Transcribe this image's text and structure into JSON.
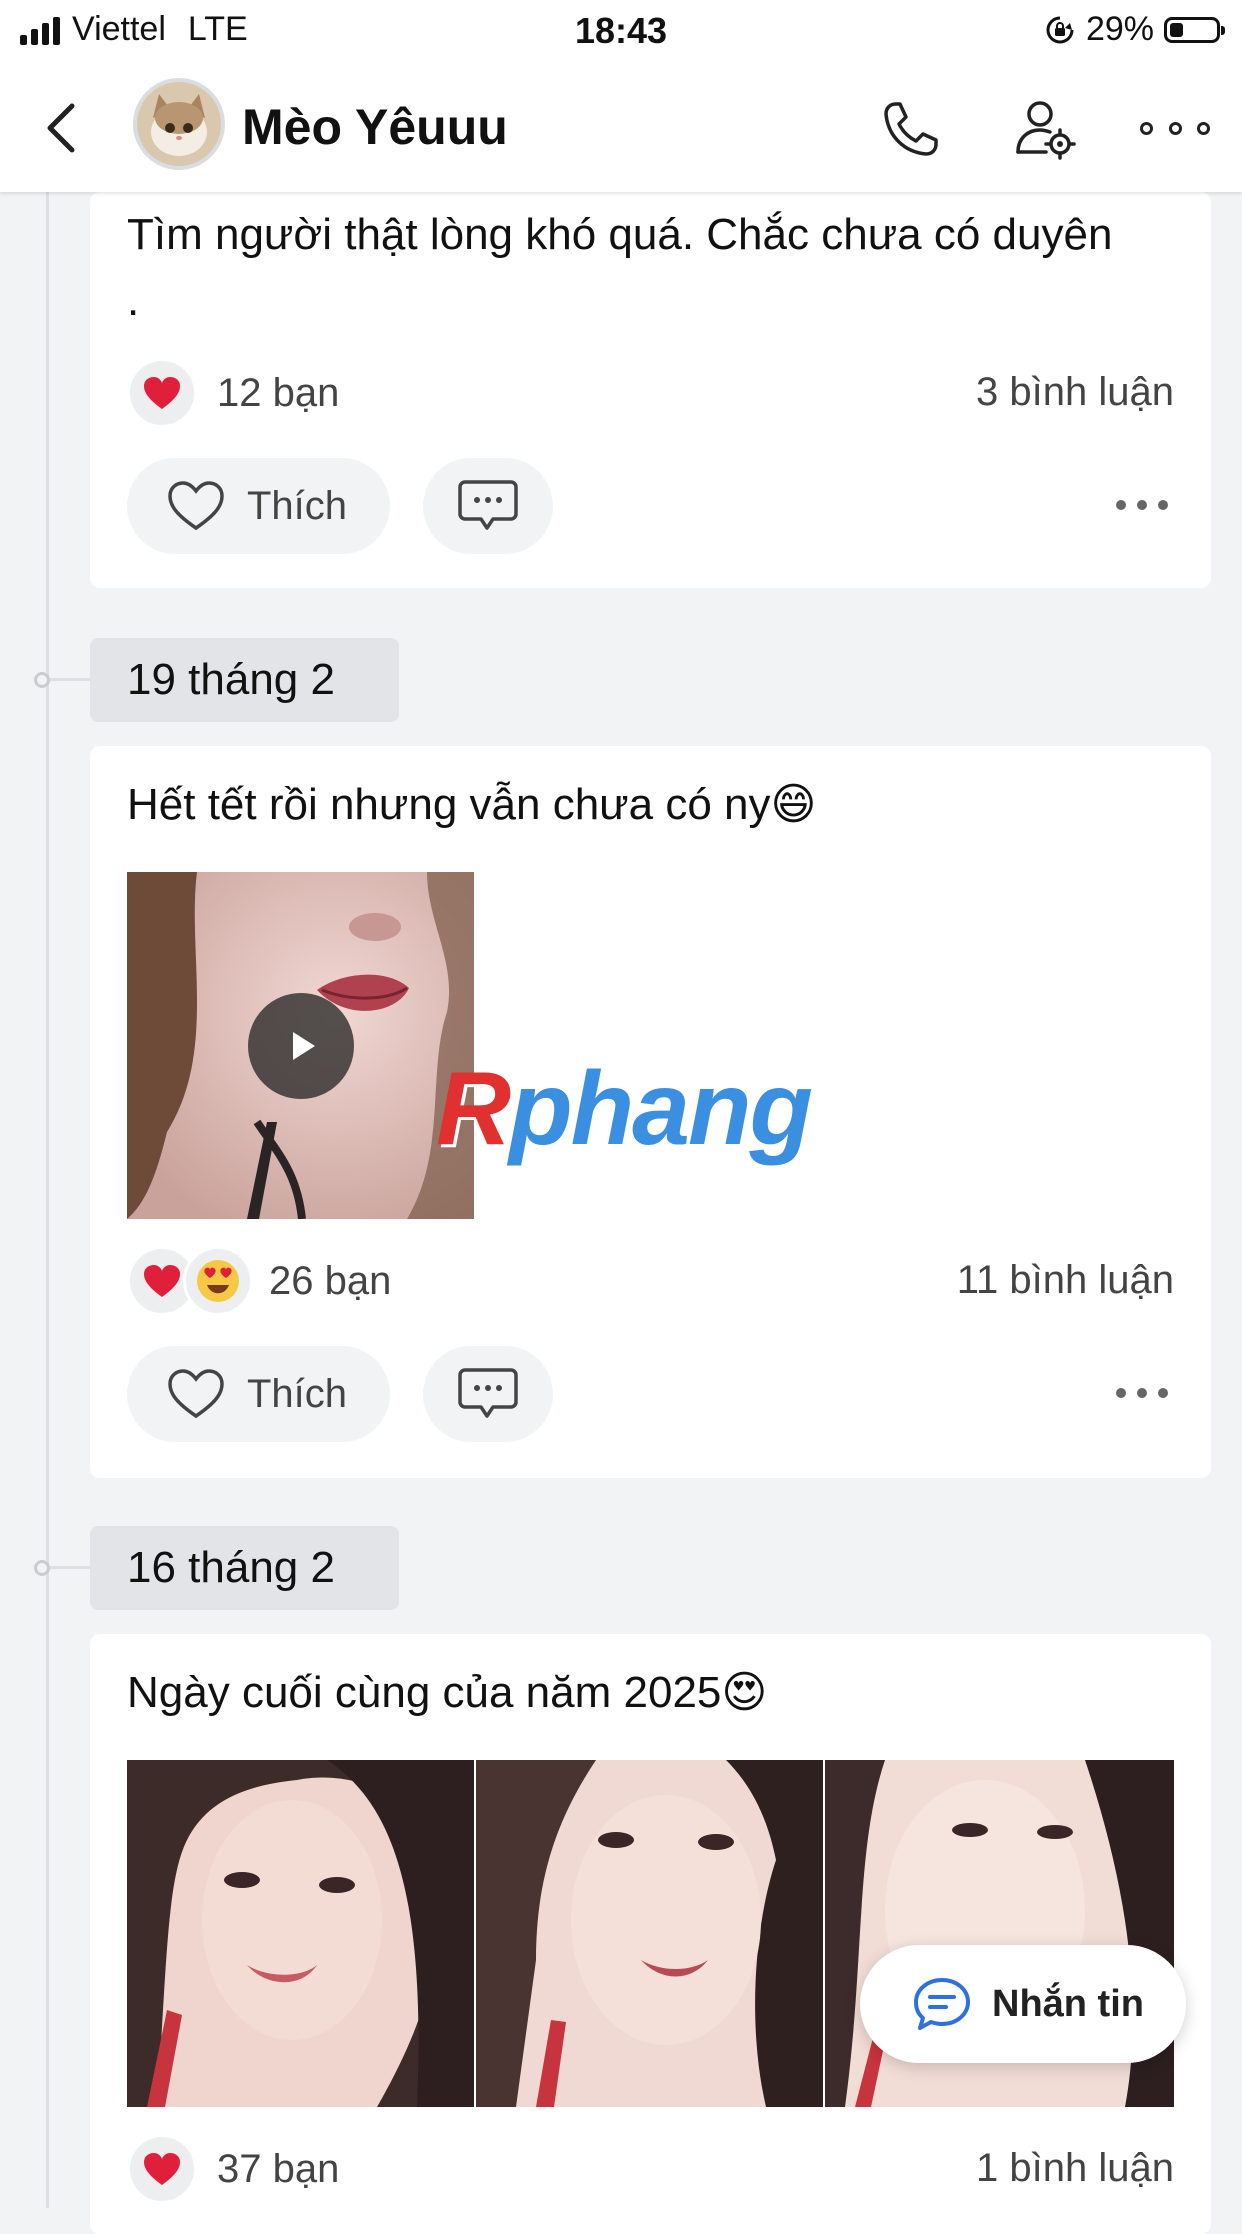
{
  "status_bar": {
    "carrier": "Viettel",
    "network": "LTE",
    "time": "18:43",
    "battery": "29%",
    "battery_level": 0.29
  },
  "header": {
    "name": "Mèo Yêuuu",
    "icons": [
      "back-chevron-icon",
      "phone-icon",
      "profile-settings-icon",
      "more-icon"
    ]
  },
  "posts": [
    {
      "text": "Tìm người thật lòng khó quá. Chắc chưa có duyên .",
      "reactions": "12 bạn",
      "comments": "3 bình luận",
      "like_label": "Thích"
    },
    {
      "date": "19 tháng 2",
      "text": "Hết tết rồi nhưng vẫn chưa có ny😄",
      "reactions": "26 bạn",
      "comments": "11 bình luận",
      "like_label": "Thích"
    },
    {
      "date": "16 tháng 2",
      "text": "Ngày cuối cùng của năm 2025😍",
      "reactions": "37 bạn",
      "comments": "1 bình luận"
    }
  ],
  "watermark": {
    "part1": "R",
    "part2": "phang"
  },
  "message_button": {
    "label": "Nhắn tin"
  },
  "colors": {
    "accent_blue": "#2f6fe0",
    "heart_red": "#e0203a"
  }
}
